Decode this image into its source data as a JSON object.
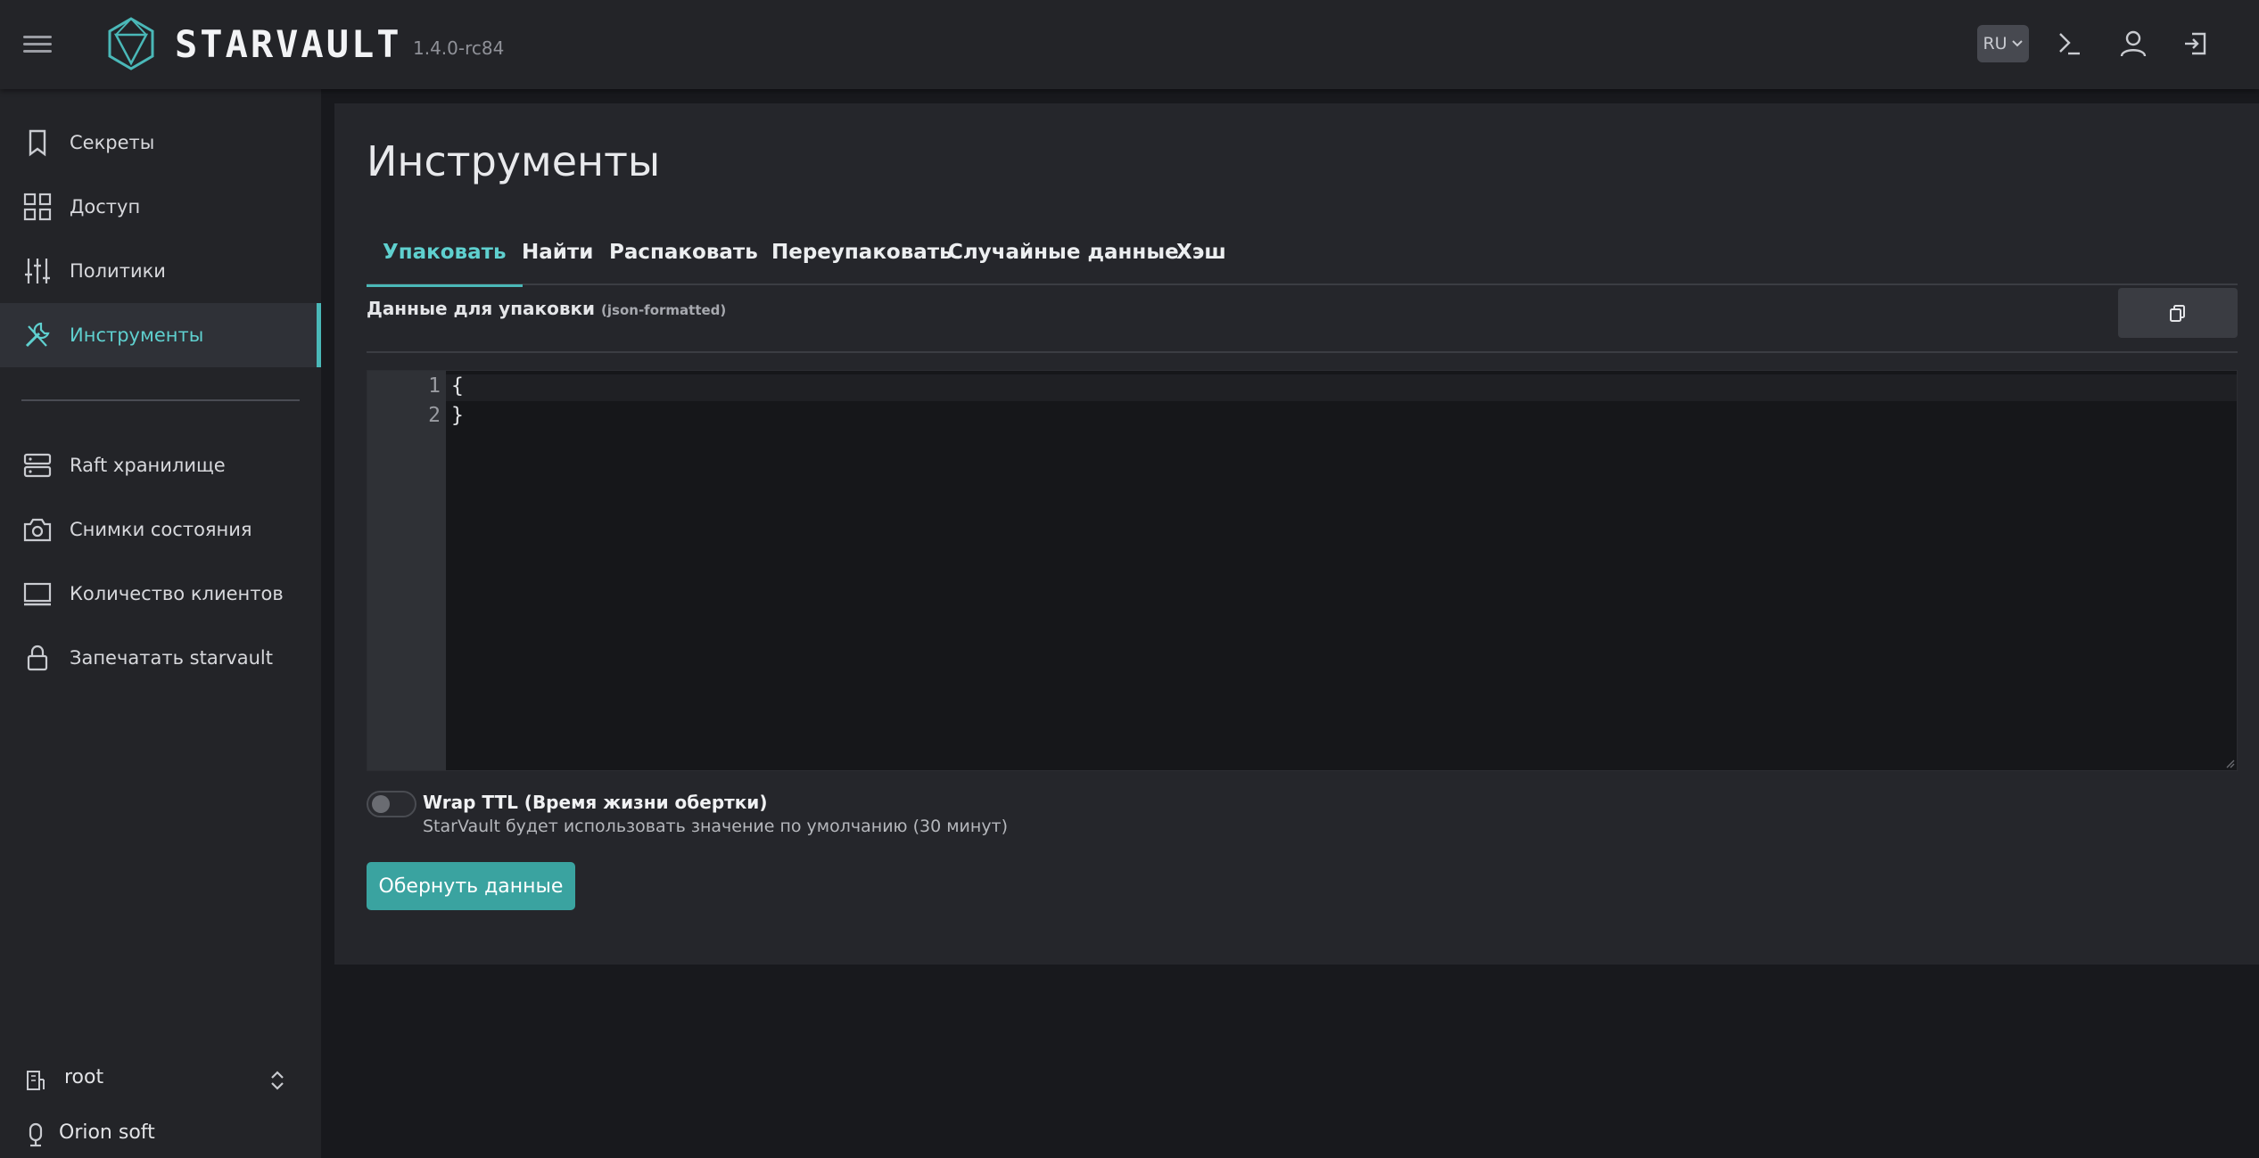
{
  "header": {
    "brand": "STARVAULT",
    "version": "1.4.0-rc84",
    "language": "RU",
    "icons": [
      "menu-icon",
      "logo-icon",
      "chevron-down-icon",
      "terminal-icon",
      "user-icon",
      "logout-icon"
    ]
  },
  "sidebar": {
    "items": [
      {
        "label": "Секреты",
        "icon": "bookmark-icon"
      },
      {
        "label": "Доступ",
        "icon": "grid-icon"
      },
      {
        "label": "Политики",
        "icon": "sliders-icon"
      },
      {
        "label": "Инструменты",
        "icon": "tools-icon",
        "active": true
      }
    ],
    "secondary": [
      {
        "label": "Raft хранилище",
        "icon": "server-icon"
      },
      {
        "label": "Снимки состояния",
        "icon": "camera-icon"
      },
      {
        "label": "Количество клиентов",
        "icon": "monitor-icon"
      },
      {
        "label": "Запечатать starvault",
        "icon": "lock-icon"
      }
    ],
    "namespace": "root",
    "organization": "Orion soft"
  },
  "main": {
    "title": "Инструменты",
    "tabs": [
      {
        "label": "Упаковать",
        "active": true
      },
      {
        "label": "Найти"
      },
      {
        "label": "Распаковать"
      },
      {
        "label": "Переупаковать"
      },
      {
        "label": "Случайные данные"
      },
      {
        "label": "Хэш"
      }
    ],
    "field_label": "Данные для упаковки",
    "field_hint": "(json-formatted)",
    "editor": {
      "line_numbers": [
        "1",
        "2"
      ],
      "lines": [
        "{",
        "}"
      ]
    },
    "ttl_title": "Wrap TTL (Время жизни обертки)",
    "ttl_subtitle": "StarVault будет использовать значение по умолчанию (30 минут)",
    "ttl_enabled": false,
    "submit_label": "Обернуть данные"
  },
  "colors": {
    "accent": "#4ab8b8",
    "active_text": "#5fd0cf",
    "button": "#3aa3a0",
    "background": "#18191d",
    "panel": "#25262b",
    "sidebar": "#232428"
  }
}
